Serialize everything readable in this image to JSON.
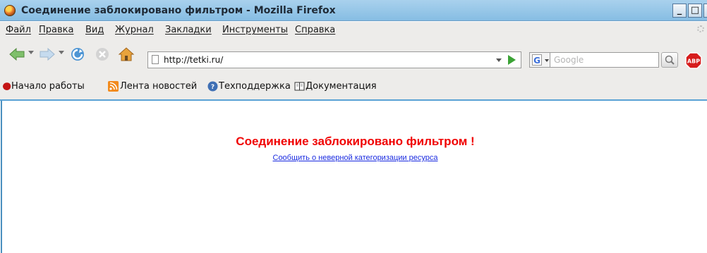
{
  "window": {
    "title": "Соединение заблокировано фильтром - Mozilla Firefox",
    "minimize": "_",
    "maximize": "□",
    "close": "X"
  },
  "menu": [
    {
      "label": "Файл"
    },
    {
      "label": "Правка"
    },
    {
      "label": "Вид"
    },
    {
      "label": "Журнал"
    },
    {
      "label": "Закладки"
    },
    {
      "label": "Инструменты"
    },
    {
      "label": "Справка"
    }
  ],
  "nav": {
    "url": "http://tetki.ru/",
    "search_engine_icon": "G",
    "search_placeholder": "Google",
    "adblock_label": "ABP"
  },
  "bookmarks": [
    {
      "label": "Начало работы",
      "icon": "firefox-start-icon"
    },
    {
      "label": "Лента новостей",
      "icon": "rss-feed-icon"
    },
    {
      "label": "Техподдержка",
      "icon": "help-icon"
    },
    {
      "label": "Документация",
      "icon": "book-icon"
    }
  ],
  "page": {
    "heading": "Соединение заблокировано фильтром !",
    "report_link": "Сообщить о неверной категоризации ресурса"
  },
  "colors": {
    "heading": "#f00000",
    "link": "#1a2be0",
    "titlebar": "#a9d1ed",
    "toolbar": "#edecea"
  }
}
